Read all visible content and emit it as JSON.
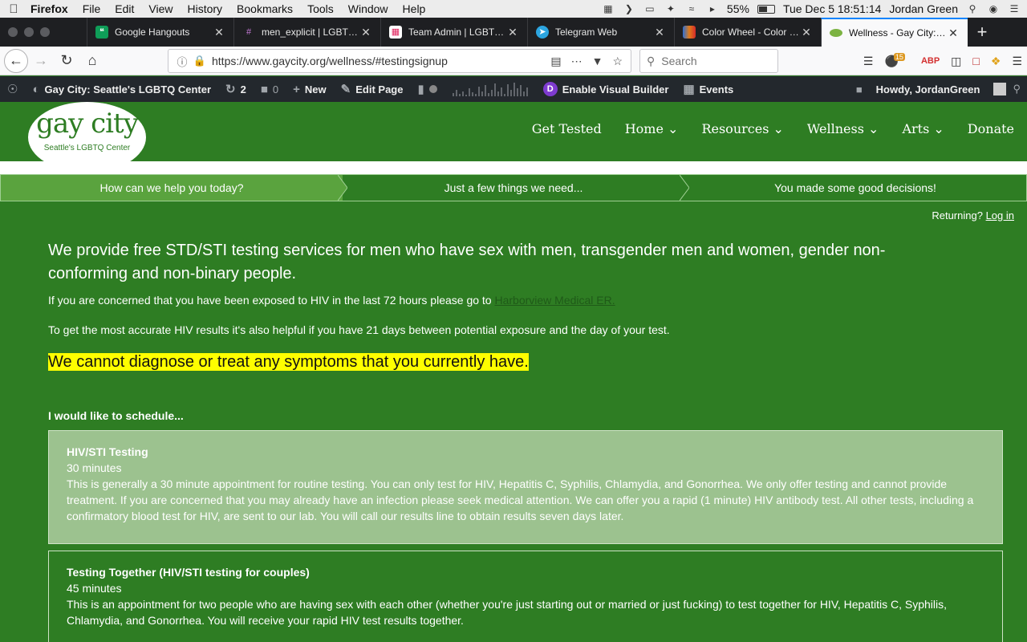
{
  "menubar": {
    "app": "Firefox",
    "items": [
      "File",
      "Edit",
      "View",
      "History",
      "Bookmarks",
      "Tools",
      "Window",
      "Help"
    ],
    "battery": "55%",
    "datetime": "Tue Dec 5  18:51:14",
    "user": "Jordan Green"
  },
  "tabs": [
    {
      "title": "Google Hangouts",
      "icon_color": "#0f9d58"
    },
    {
      "title": "men_explicit | LGBTQ in",
      "icon_color": "#4a154b"
    },
    {
      "title": "Team Admin | LGBTQ in",
      "icon_color": "#e01e5a"
    },
    {
      "title": "Telegram Web",
      "icon_color": "#2ca5e0"
    },
    {
      "title": "Color Wheel - Color Ca",
      "icon_color": "#e07b1a"
    },
    {
      "title": "Wellness - Gay City: Se",
      "icon_color": "#7cb342"
    }
  ],
  "nav": {
    "url": "https://www.gaycity.org/wellness/#testingsignup",
    "search_placeholder": "Search",
    "badge": "15"
  },
  "wpbar": {
    "site": "Gay City: Seattle's LGBTQ Center",
    "updates": "2",
    "comments": "0",
    "new_label": "New",
    "edit_label": "Edit Page",
    "visual_builder": "Enable Visual Builder",
    "events": "Events",
    "howdy": "Howdy, JordanGreen"
  },
  "site": {
    "logo_line1": "gay city",
    "logo_line2": "Seattle's LGBTQ Center",
    "nav": [
      {
        "label": "Get Tested",
        "caret": ""
      },
      {
        "label": "Home",
        "caret": "⌄"
      },
      {
        "label": "Resources",
        "caret": "⌄"
      },
      {
        "label": "Wellness",
        "caret": "⌄"
      },
      {
        "label": "Arts",
        "caret": "⌄"
      },
      {
        "label": "Donate",
        "caret": ""
      }
    ]
  },
  "steps": [
    "How can we help you today?",
    "Just a few things we need...",
    "You made some good decisions!"
  ],
  "returning": {
    "text": "Returning?",
    "link": "Log in"
  },
  "content": {
    "lead": "We provide free STD/STI testing services for men who have sex with men, transgender men and women, gender non-conforming and non-binary people.",
    "exposure_text": "If you are concerned that you have been exposed to HIV in the last 72 hours please go to ",
    "exposure_link": "Harborview Medical ER.",
    "accuracy": "To get the most accurate HIV results it's also helpful if you have 21 days between potential exposure and the day of your test.",
    "warning": "We cannot diagnose or treat any symptoms that you currently have.",
    "schedule_label": "I would like to schedule..."
  },
  "services": [
    {
      "title": "HIV/STI Testing",
      "duration": "30 minutes",
      "description": "This is generally a 30 minute appointment for routine testing. You can only test for HIV, Hepatitis C, Syphilis, Chlamydia, and Gonorrhea. We only offer testing and cannot provide treatment. If you are concerned that you may already have an infection please seek medical attention. We can offer you a rapid (1 minute) HIV antibody test. All other tests, including a confirmatory blood test for HIV, are sent to our lab. You will call our results line to obtain results seven days later."
    },
    {
      "title": "Testing Together (HIV/STI testing for couples)",
      "duration": "45 minutes",
      "description": "This is an appointment for two people who are having sex with each other (whether you're just starting out or married or just fucking) to test together for HIV, Hepatitis C, Syphilis, Chlamydia, and Gonorrhea. You will receive your rapid HIV test results together."
    }
  ]
}
